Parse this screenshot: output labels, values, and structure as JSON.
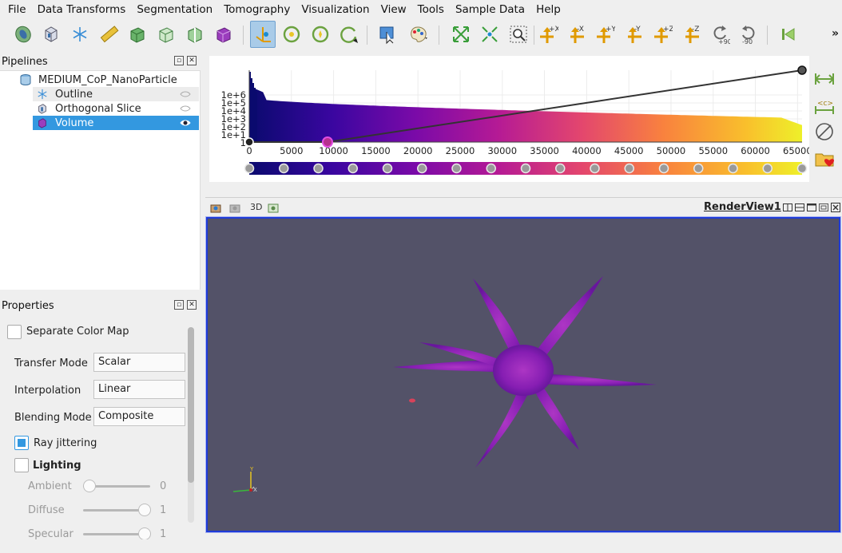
{
  "menu": [
    "File",
    "Data Transforms",
    "Segmentation",
    "Tomography",
    "Visualization",
    "View",
    "Tools",
    "Sample Data",
    "Help"
  ],
  "toolbar": {
    "icons": [
      "reconstruct-icon",
      "volume-cube-icon",
      "snowflake-icon",
      "ruler-icon",
      "box-3d-icon",
      "outline-box-icon",
      "cut-box-icon",
      "purple-cube-icon",
      "interact-axes-icon",
      "reset-camera-icon",
      "center-rotation-icon",
      "rotate-icon",
      "pick-icon",
      "color-palette-icon",
      "zoom-extents-icon",
      "reset-zoom-icon",
      "zoom-box-icon",
      "view-plus-x-icon",
      "view-minus-x-icon",
      "view-plus-y-icon",
      "view-minus-y-icon",
      "view-plus-z-icon",
      "view-minus-z-icon",
      "rotate-plus-90-icon",
      "rotate-minus-90-icon",
      "first-frame-icon"
    ],
    "axis_labels": [
      "+X",
      "-X",
      "+Y",
      "-Y",
      "+Z",
      "-Z"
    ],
    "rotate_labels": [
      "+90",
      "-90"
    ],
    "more": "»"
  },
  "pipelines": {
    "title": "Pipelines",
    "root": "MEDIUM_CoP_NanoParticle",
    "items": [
      {
        "label": "Outline",
        "icon": "snowflake-icon",
        "visible": false
      },
      {
        "label": "Orthogonal Slice",
        "icon": "slice-icon",
        "visible": false
      },
      {
        "label": "Volume",
        "icon": "volume-icon",
        "visible": true,
        "selected": true
      }
    ]
  },
  "properties": {
    "title": "Properties",
    "separate_color_map": "Separate Color Map",
    "transfer_mode_label": "Transfer Mode",
    "transfer_mode_value": "Scalar",
    "interpolation_label": "Interpolation",
    "interpolation_value": "Linear",
    "blending_label": "Blending Mode",
    "blending_value": "Composite",
    "ray_jittering": "Ray jittering",
    "lighting": "Lighting",
    "ambient_label": "Ambient",
    "ambient_value": "0",
    "diffuse_label": "Diffuse",
    "diffuse_value": "1",
    "specular_label": "Specular",
    "specular_value": "1",
    "ambient_level": 0,
    "diffuse_level": 1,
    "specular_level": 1
  },
  "histogram": {
    "x_ticks": [
      "0",
      "5000",
      "10000",
      "15000",
      "20000",
      "25000",
      "30000",
      "35000",
      "40000",
      "45000",
      "50000",
      "55000",
      "60000",
      "65000"
    ],
    "y_ticks": [
      "1e+6",
      "1e+5",
      "1e+4",
      "1e+3",
      "1e+2",
      "1e+1",
      "1"
    ],
    "colors": [
      "#0a0a6e",
      "#3a06a0",
      "#7a0aa8",
      "#b51a95",
      "#e3466e",
      "#f9823e",
      "#f9c02c",
      "#eef02a"
    ]
  },
  "render_view": {
    "title": "RenderView1",
    "mode": "3D",
    "background": "#535268"
  }
}
